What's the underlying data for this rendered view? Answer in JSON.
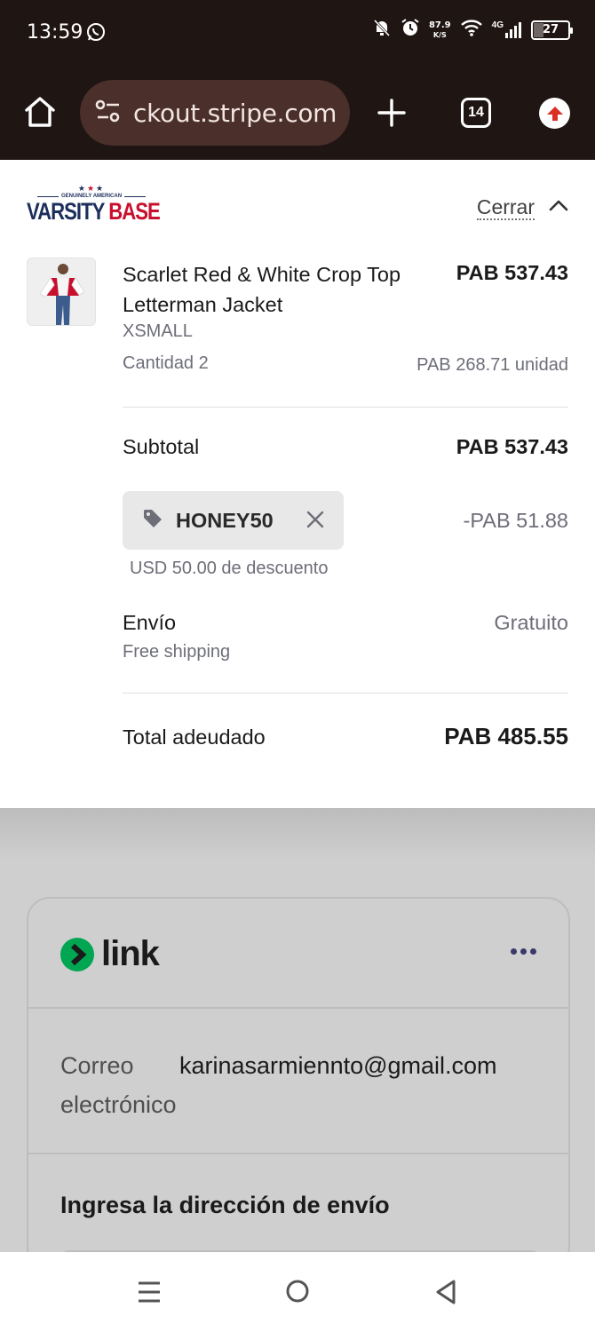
{
  "status_bar": {
    "time": "13:59",
    "net_speed_value": "87.9",
    "net_speed_unit": "K/S",
    "signal_label": "4G",
    "battery": "27"
  },
  "browser": {
    "url": "ckout.stripe.com",
    "tab_count": "14"
  },
  "summary": {
    "brand_small": "GENUINELY AMERICAN",
    "brand_main_1": "VARSITY",
    "brand_main_2": "BASE",
    "close_label": "Cerrar",
    "item": {
      "name": "Scarlet Red & White Crop Top Letterman Jacket",
      "price": "PAB 537.43",
      "variant": "XSMALL",
      "quantity": "Cantidad 2",
      "unit_price": "PAB 268.71 unidad"
    },
    "subtotal_label": "Subtotal",
    "subtotal_value": "PAB 537.43",
    "promo": {
      "code": "HONEY50",
      "amount": "-PAB 51.88",
      "description": "USD 50.00 de descuento"
    },
    "shipping": {
      "label": "Envío",
      "method": "Free shipping",
      "value": "Gratuito"
    },
    "total_label": "Total adeudado",
    "total_value": "PAB 485.55"
  },
  "link_card": {
    "brand": "link",
    "email_label": "Correo electrónico",
    "email_value": "karinasarmiennto@gmail.com",
    "address_title": "Ingresa la dirección de envío"
  },
  "colors": {
    "chrome_bg": "#1f1513",
    "url_pill_bg": "#4a2f2a",
    "brand_navy": "#1c2e5b",
    "brand_red": "#c8102e",
    "link_green": "#00a651",
    "overlay_bg": "#cfcfcf"
  }
}
